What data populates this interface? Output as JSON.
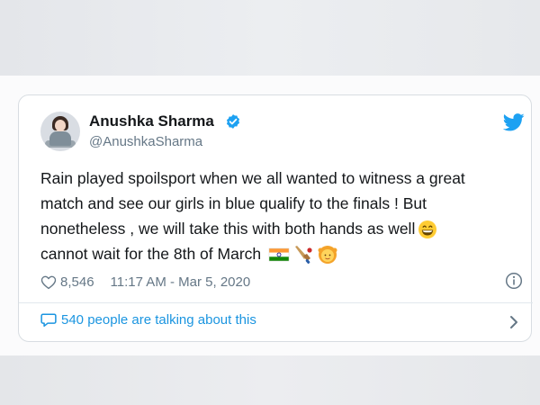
{
  "tweet": {
    "author_name": "Anushka Sharma",
    "author_handle": "@AnushkaSharma",
    "verified": true,
    "text_lines": [
      "Rain played spoilsport when we all wanted to witness a great",
      "match and see our girls in blue qualify to the finals ! But",
      "nonetheless , we will take this with both hands as well",
      " cannot wait for the 8th of March"
    ],
    "emojis": [
      "grinning-face",
      "india-flag",
      "cricket",
      "girl"
    ],
    "likes": "8,546",
    "timestamp": "11:17 AM - Mar 5, 2020",
    "talking_text": "540 people are talking about this"
  },
  "colors": {
    "twitter_blue": "#1da1f2",
    "link_blue": "#1b95e0",
    "text": "#14171a",
    "muted": "#657786"
  },
  "icons": [
    "verified-badge-icon",
    "twitter-bird-icon",
    "heart-icon",
    "info-icon",
    "speech-bubble-icon",
    "chevron-right-icon"
  ]
}
